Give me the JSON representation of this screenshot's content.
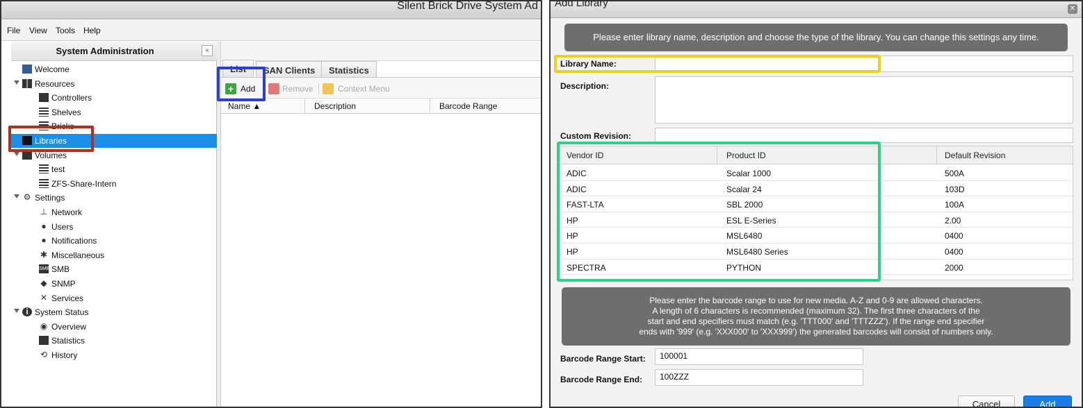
{
  "left_window": {
    "title": "Silent Brick Drive System Ad",
    "menu": [
      "File",
      "View",
      "Tools",
      "Help"
    ],
    "panel_title": "System Administration",
    "collapse_glyph": "«",
    "tree": [
      {
        "label": "Welcome",
        "icon": "welcome-icon",
        "level": 0
      },
      {
        "label": "Resources",
        "icon": "resources-icon",
        "level": 0,
        "expanded": true
      },
      {
        "label": "Controllers",
        "icon": "controller-icon",
        "level": 1
      },
      {
        "label": "Shelves",
        "icon": "shelves-icon",
        "level": 1
      },
      {
        "label": "Bricks",
        "icon": "bricks-icon",
        "level": 1
      },
      {
        "label": "Libraries",
        "icon": "folder-icon",
        "level": 0,
        "selected": true
      },
      {
        "label": "Volumes",
        "icon": "volumes-icon",
        "level": 0,
        "expanded": true
      },
      {
        "label": "test",
        "icon": "list-icon",
        "level": 1
      },
      {
        "label": "ZFS-Share-Intern",
        "icon": "list-icon",
        "level": 1
      },
      {
        "label": "Settings",
        "icon": "gear-icon",
        "level": 0,
        "expanded": true
      },
      {
        "label": "Network",
        "icon": "network-icon",
        "level": 1
      },
      {
        "label": "Users",
        "icon": "user-icon",
        "level": 1
      },
      {
        "label": "Notifications",
        "icon": "bell-icon",
        "level": 1
      },
      {
        "label": "Miscellaneous",
        "icon": "asterisk-icon",
        "level": 1
      },
      {
        "label": "SMB",
        "icon": "smb-icon",
        "level": 1,
        "icon_text": "SMB"
      },
      {
        "label": "SNMP",
        "icon": "snmp-icon",
        "level": 1
      },
      {
        "label": "Services",
        "icon": "tools-icon",
        "level": 1
      },
      {
        "label": "System Status",
        "icon": "info-icon",
        "level": 0,
        "expanded": true
      },
      {
        "label": "Overview",
        "icon": "eye-icon",
        "level": 1
      },
      {
        "label": "Statistics",
        "icon": "bar-chart-icon",
        "level": 1
      },
      {
        "label": "History",
        "icon": "history-icon",
        "level": 1
      }
    ],
    "tabs": [
      "List",
      "SAN Clients",
      "Statistics"
    ],
    "toolbar": {
      "add": "Add",
      "remove": "Remove",
      "context_menu": "Context Menu",
      "add_glyph": "+"
    },
    "columns": [
      "Name ▲",
      "Description",
      "Barcode Range"
    ]
  },
  "dialog": {
    "title": "Add Library",
    "close_glyph": "✕",
    "intro": "Please enter library name, description and choose the type of the library. You can change this settings any time.",
    "library_name_label": "Library Name:",
    "library_name_value": "",
    "description_label": "Description:",
    "description_value": "",
    "custom_revision_label": "Custom Revision:",
    "custom_revision_value": "",
    "grid_columns": [
      "Vendor ID",
      "Product ID",
      "Default Revision"
    ],
    "grid_rows": [
      [
        "ADIC",
        "Scalar 1000",
        "500A"
      ],
      [
        "ADIC",
        "Scalar 24",
        "103D"
      ],
      [
        "FAST-LTA",
        "SBL 2000",
        "100A"
      ],
      [
        "HP",
        "ESL E-Series",
        "2.00"
      ],
      [
        "HP",
        "MSL6480",
        "0400"
      ],
      [
        "HP",
        "MSL6480 Series",
        "0400"
      ],
      [
        "SPECTRA",
        "PYTHON",
        "2000"
      ]
    ],
    "barcode_info": [
      "Please enter the barcode range to use for new media. A-Z and 0-9 are allowed characters.",
      "A length of 6 characters is recommended (maximum 32). The first three characters of the",
      "start and end specifiers must match (e.g. 'TTT000' and 'TTTZZZ'). If the range end specifier",
      "ends with '999' (e.g. 'XXX000' to 'XXX999') the generated barcodes will consist of numbers only."
    ],
    "barcode_start_label": "Barcode Range Start:",
    "barcode_start_value": "100001",
    "barcode_end_label": "Barcode Range End:",
    "barcode_end_value": "100ZZZ",
    "cancel_label": "Cancel",
    "add_label": "Add"
  },
  "colors": {
    "selection_blue": "#1a8fe6",
    "highlight_red": "#b03020",
    "highlight_blue": "#2b3fd1",
    "highlight_yellow": "#e8d21e",
    "highlight_green": "#2fd189",
    "add_green": "#3aa83a"
  }
}
